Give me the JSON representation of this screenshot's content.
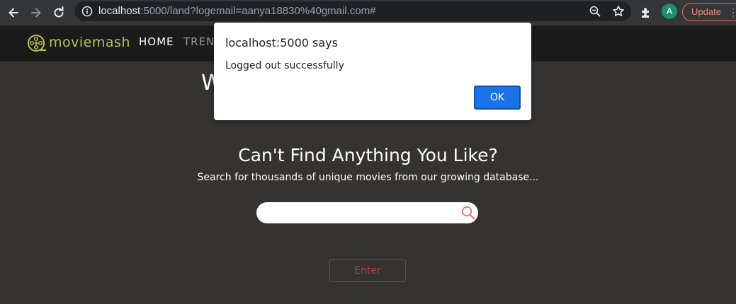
{
  "browser": {
    "url_host": "localhost",
    "url_rest": ":5000/land?logemail=aanya18830%40gmail.com#",
    "avatar_letter": "A",
    "update_label": "Update",
    "menu_glyph": "⋮"
  },
  "navbar": {
    "logo_text": "moviemash",
    "items": [
      {
        "label": "HOME"
      },
      {
        "label": "TREN"
      }
    ]
  },
  "page": {
    "welcome_partial": "W",
    "headline": "Can't Find Anything You Like?",
    "subline": "Search for thousands of unique movies from our growing database...",
    "search_placeholder": "",
    "enter_label": "Enter"
  },
  "dialog": {
    "title": "localhost:5000 says",
    "message": "Logged out successfully",
    "ok_label": "OK"
  },
  "colors": {
    "page_bg": "#35332f",
    "navbar_bg": "#1b1b1b",
    "logo_accent": "#b9c255",
    "enter_accent": "#b04040",
    "ok_button": "#1a73e8",
    "search_icon": "#e57373"
  }
}
